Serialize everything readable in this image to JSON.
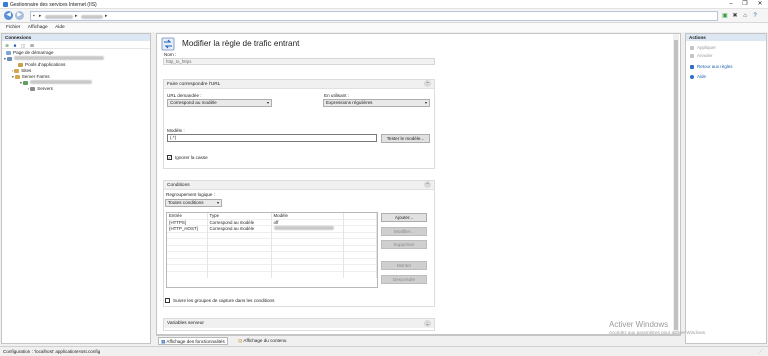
{
  "window": {
    "title": "Gestionnaire des services Internet (IIS)"
  },
  "address": {
    "segments": [
      "▸",
      "▸",
      "▸"
    ]
  },
  "menu": [
    "Fichier",
    "Affichage",
    "Aide"
  ],
  "connections": {
    "header": "Connexions",
    "tree": [
      {
        "label": "Page de démarrage"
      },
      {
        "label": ""
      },
      {
        "label": "Pools d'applications"
      },
      {
        "label": "Sites"
      },
      {
        "label": "Server Farms"
      },
      {
        "label": ""
      },
      {
        "label": "Servers"
      }
    ]
  },
  "page": {
    "title": "Modifier la règle de trafic entrant",
    "name_label": "Nom :",
    "name_value": "http_to_https",
    "match_section": {
      "title": "Faire correspondre l'URL",
      "url_label": "URL demandée :",
      "url_value": "Correspond au modèle",
      "using_label": "En utilisant :",
      "using_value": "Expressions régulières",
      "pattern_label": "Modèle :",
      "pattern_value": "(.*)",
      "test_button": "Tester le modèle...",
      "ignore_case_label": "Ignorer la casse",
      "ignore_case_checked": true
    },
    "conditions_section": {
      "title": "Conditions",
      "grouping_label": "Regroupement logique :",
      "grouping_value": "Toutes conditions",
      "columns": [
        "Entrée",
        "Type",
        "Modèle"
      ],
      "rows": [
        [
          "{HTTPS}",
          "Correspond au modèle",
          "off"
        ],
        [
          "{HTTP_HOST}",
          "Correspond au modèle",
          ""
        ]
      ],
      "buttons": {
        "add": "Ajouter...",
        "edit": "Modifier...",
        "delete": "Supprimer",
        "up": "Monter",
        "down": "Descendre"
      },
      "track_groups_label": "Suivre les groupes de capture dans les conditions"
    },
    "server_vars_section": {
      "title": "Variables serveur"
    }
  },
  "tabs": {
    "features": "Affichage des fonctionnalités",
    "content": "Affichage du contenu"
  },
  "actions": {
    "header": "Actions",
    "items": [
      {
        "label": "Appliquer",
        "enabled": false
      },
      {
        "label": "Annuler",
        "enabled": false
      },
      {
        "label": "Retour aux règles",
        "enabled": true
      },
      {
        "label": "Aide",
        "enabled": true
      }
    ]
  },
  "status": {
    "text": "Configuration : 'localhost' applicationHost.config"
  },
  "watermark": {
    "line1": "Activer Windows",
    "line2": "Accédez aux paramètres pour activer Windows."
  },
  "colors": {
    "accent": "#1c5fb0",
    "header_bg": "#dde7f3",
    "link": "#1c5fb0"
  }
}
